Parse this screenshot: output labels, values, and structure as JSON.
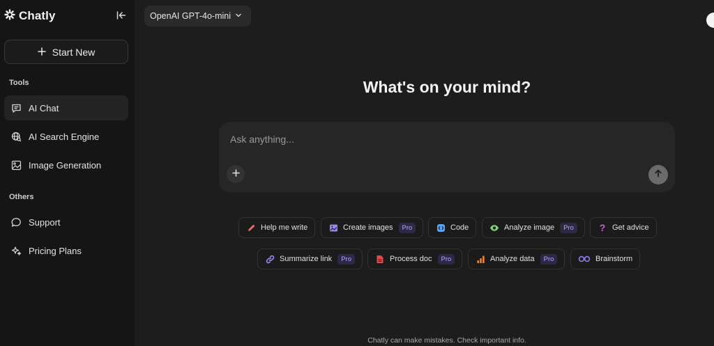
{
  "sidebar": {
    "brand": "Chatly",
    "start_new": "Start New",
    "tools_label": "Tools",
    "others_label": "Others",
    "tools": [
      {
        "label": "AI Chat",
        "icon": "chat-bubble-icon",
        "active": true
      },
      {
        "label": "AI Search Engine",
        "icon": "globe-search-icon",
        "active": false
      },
      {
        "label": "Image Generation",
        "icon": "image-icon",
        "active": false
      }
    ],
    "others": [
      {
        "label": "Support",
        "icon": "speech-bubble-icon"
      },
      {
        "label": "Pricing Plans",
        "icon": "sparkles-icon"
      }
    ]
  },
  "header": {
    "model": "OpenAI GPT-4o-mini"
  },
  "main": {
    "headline": "What's on your mind?",
    "composer_placeholder": "Ask anything...",
    "suggestions_row1": [
      {
        "label": "Help me write",
        "icon": "pencil-icon",
        "color": "#e8726b",
        "pro": false
      },
      {
        "label": "Create images",
        "icon": "picture-icon",
        "color": "#9b86f0",
        "pro": true
      },
      {
        "label": "Code",
        "icon": "code-icon",
        "color": "#5aa6ff",
        "pro": false
      },
      {
        "label": "Analyze image",
        "icon": "eye-icon",
        "color": "#7ed07a",
        "pro": true
      },
      {
        "label": "Get advice",
        "icon": "question-icon",
        "color": "#d65ad6",
        "pro": false
      }
    ],
    "suggestions_row2": [
      {
        "label": "Summarize link",
        "icon": "link-icon",
        "color": "#9b86f0",
        "pro": true
      },
      {
        "label": "Process doc",
        "icon": "document-icon",
        "color": "#e8484a",
        "pro": true
      },
      {
        "label": "Analyze data",
        "icon": "bar-chart-icon",
        "color": "#f08a3a",
        "pro": true
      },
      {
        "label": "Brainstorm",
        "icon": "infinity-icon",
        "color": "#8f7cf2",
        "pro": false
      }
    ],
    "pro_label": "Pro",
    "footer": "Chatly can make mistakes. Check important info."
  }
}
